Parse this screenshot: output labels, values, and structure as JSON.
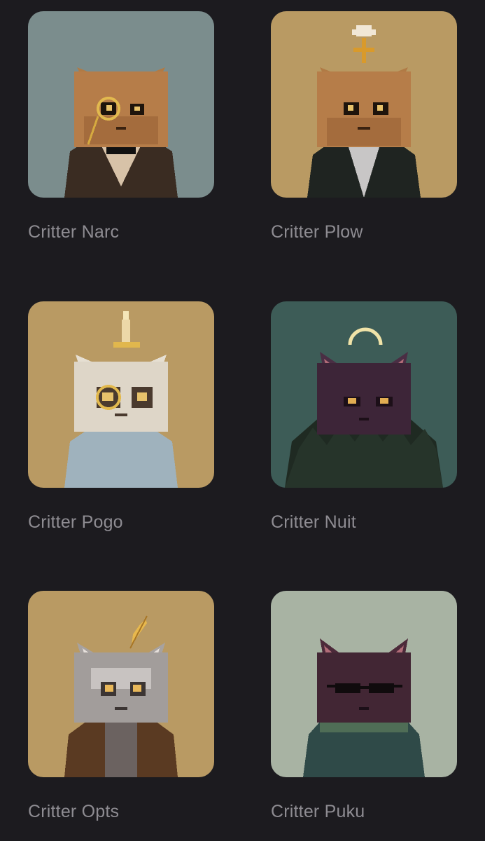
{
  "collection": {
    "items": [
      {
        "name": "Critter Narc",
        "background": "#7b8d8d",
        "accessory": "monocle"
      },
      {
        "name": "Critter Plow",
        "background": "#b99a63",
        "accessory": "flower"
      },
      {
        "name": "Critter Pogo",
        "background": "#b99a63",
        "accessory": "candle"
      },
      {
        "name": "Critter Nuit",
        "background": "#3d5c57",
        "accessory": "halo"
      },
      {
        "name": "Critter Opts",
        "background": "#b99a63",
        "accessory": "feather"
      },
      {
        "name": "Critter Puku",
        "background": "#a8b3a3",
        "accessory": "sunglasses"
      }
    ]
  },
  "colors": {
    "page_background": "#1c1b1f",
    "label_text": "#8e8c92"
  }
}
